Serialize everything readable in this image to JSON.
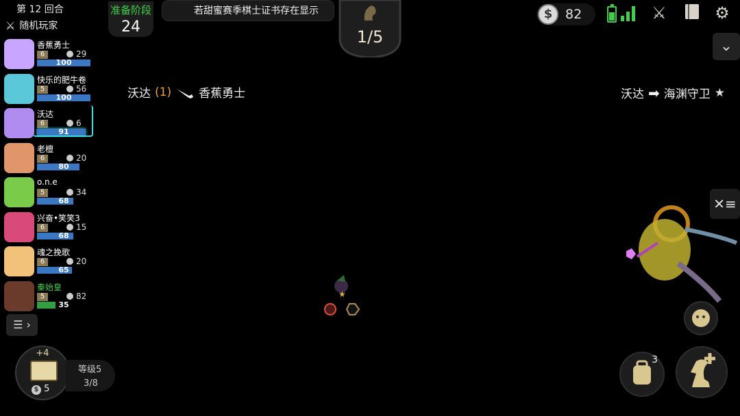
{
  "round_label": "第 12 回合",
  "mode_label": "随机玩家",
  "phase": {
    "label": "准备阶段",
    "timer": "24"
  },
  "marquee_text": "若甜蜜赛季棋士证书存在显示",
  "round_counter": "1/5",
  "coins": "82",
  "events": {
    "left": {
      "attacker": "沃达",
      "count": "(1)",
      "target": "香蕉勇士"
    },
    "right": {
      "attacker": "沃达",
      "target": "海渊守卫"
    }
  },
  "players": [
    {
      "name": "香蕉勇士",
      "level": "6",
      "gold": "29",
      "hp": "100",
      "hp_pct": 100,
      "avatar_color": "#c8a6ff",
      "style": ""
    },
    {
      "name": "快乐的肥牛卷",
      "level": "5",
      "gold": "56",
      "hp": "100",
      "hp_pct": 100,
      "avatar_color": "#5ac8d8",
      "style": ""
    },
    {
      "name": "沃达",
      "level": "6",
      "gold": "6",
      "hp": "91",
      "hp_pct": 91,
      "avatar_color": "#b08cf0",
      "style": "me"
    },
    {
      "name": "老檀",
      "level": "6",
      "gold": "20",
      "hp": "80",
      "hp_pct": 80,
      "avatar_color": "#e0956a",
      "style": ""
    },
    {
      "name": "o.n.e",
      "level": "5",
      "gold": "34",
      "hp": "68",
      "hp_pct": 68,
      "avatar_color": "#7acb4a",
      "style": ""
    },
    {
      "name": "兴奋•笑笑3",
      "level": "6",
      "gold": "15",
      "hp": "68",
      "hp_pct": 68,
      "avatar_color": "#d84a7a",
      "style": ""
    },
    {
      "name": "魂之挽歌",
      "level": "6",
      "gold": "20",
      "hp": "65",
      "hp_pct": 65,
      "avatar_color": "#f2c27a",
      "style": ""
    },
    {
      "name": "秦始皇",
      "level": "5",
      "gold": "82",
      "hp": "35",
      "hp_pct": 35,
      "avatar_color": "#6a3a2a",
      "style": "mine"
    }
  ],
  "book": {
    "bonus": "+4",
    "cost": "5"
  },
  "level": {
    "label": "等级5",
    "xp": "3/8"
  },
  "backpack_count": "3",
  "icons": [
    "crossed-swords-icon",
    "coin-icon",
    "battery-icon",
    "signal-icon",
    "battle-icon",
    "book-icon",
    "gear-icon",
    "chevron-down-icon",
    "list-icon",
    "menu-icon",
    "emoji-icon",
    "backpack-icon",
    "knight-plus-icon",
    "star-icon"
  ]
}
